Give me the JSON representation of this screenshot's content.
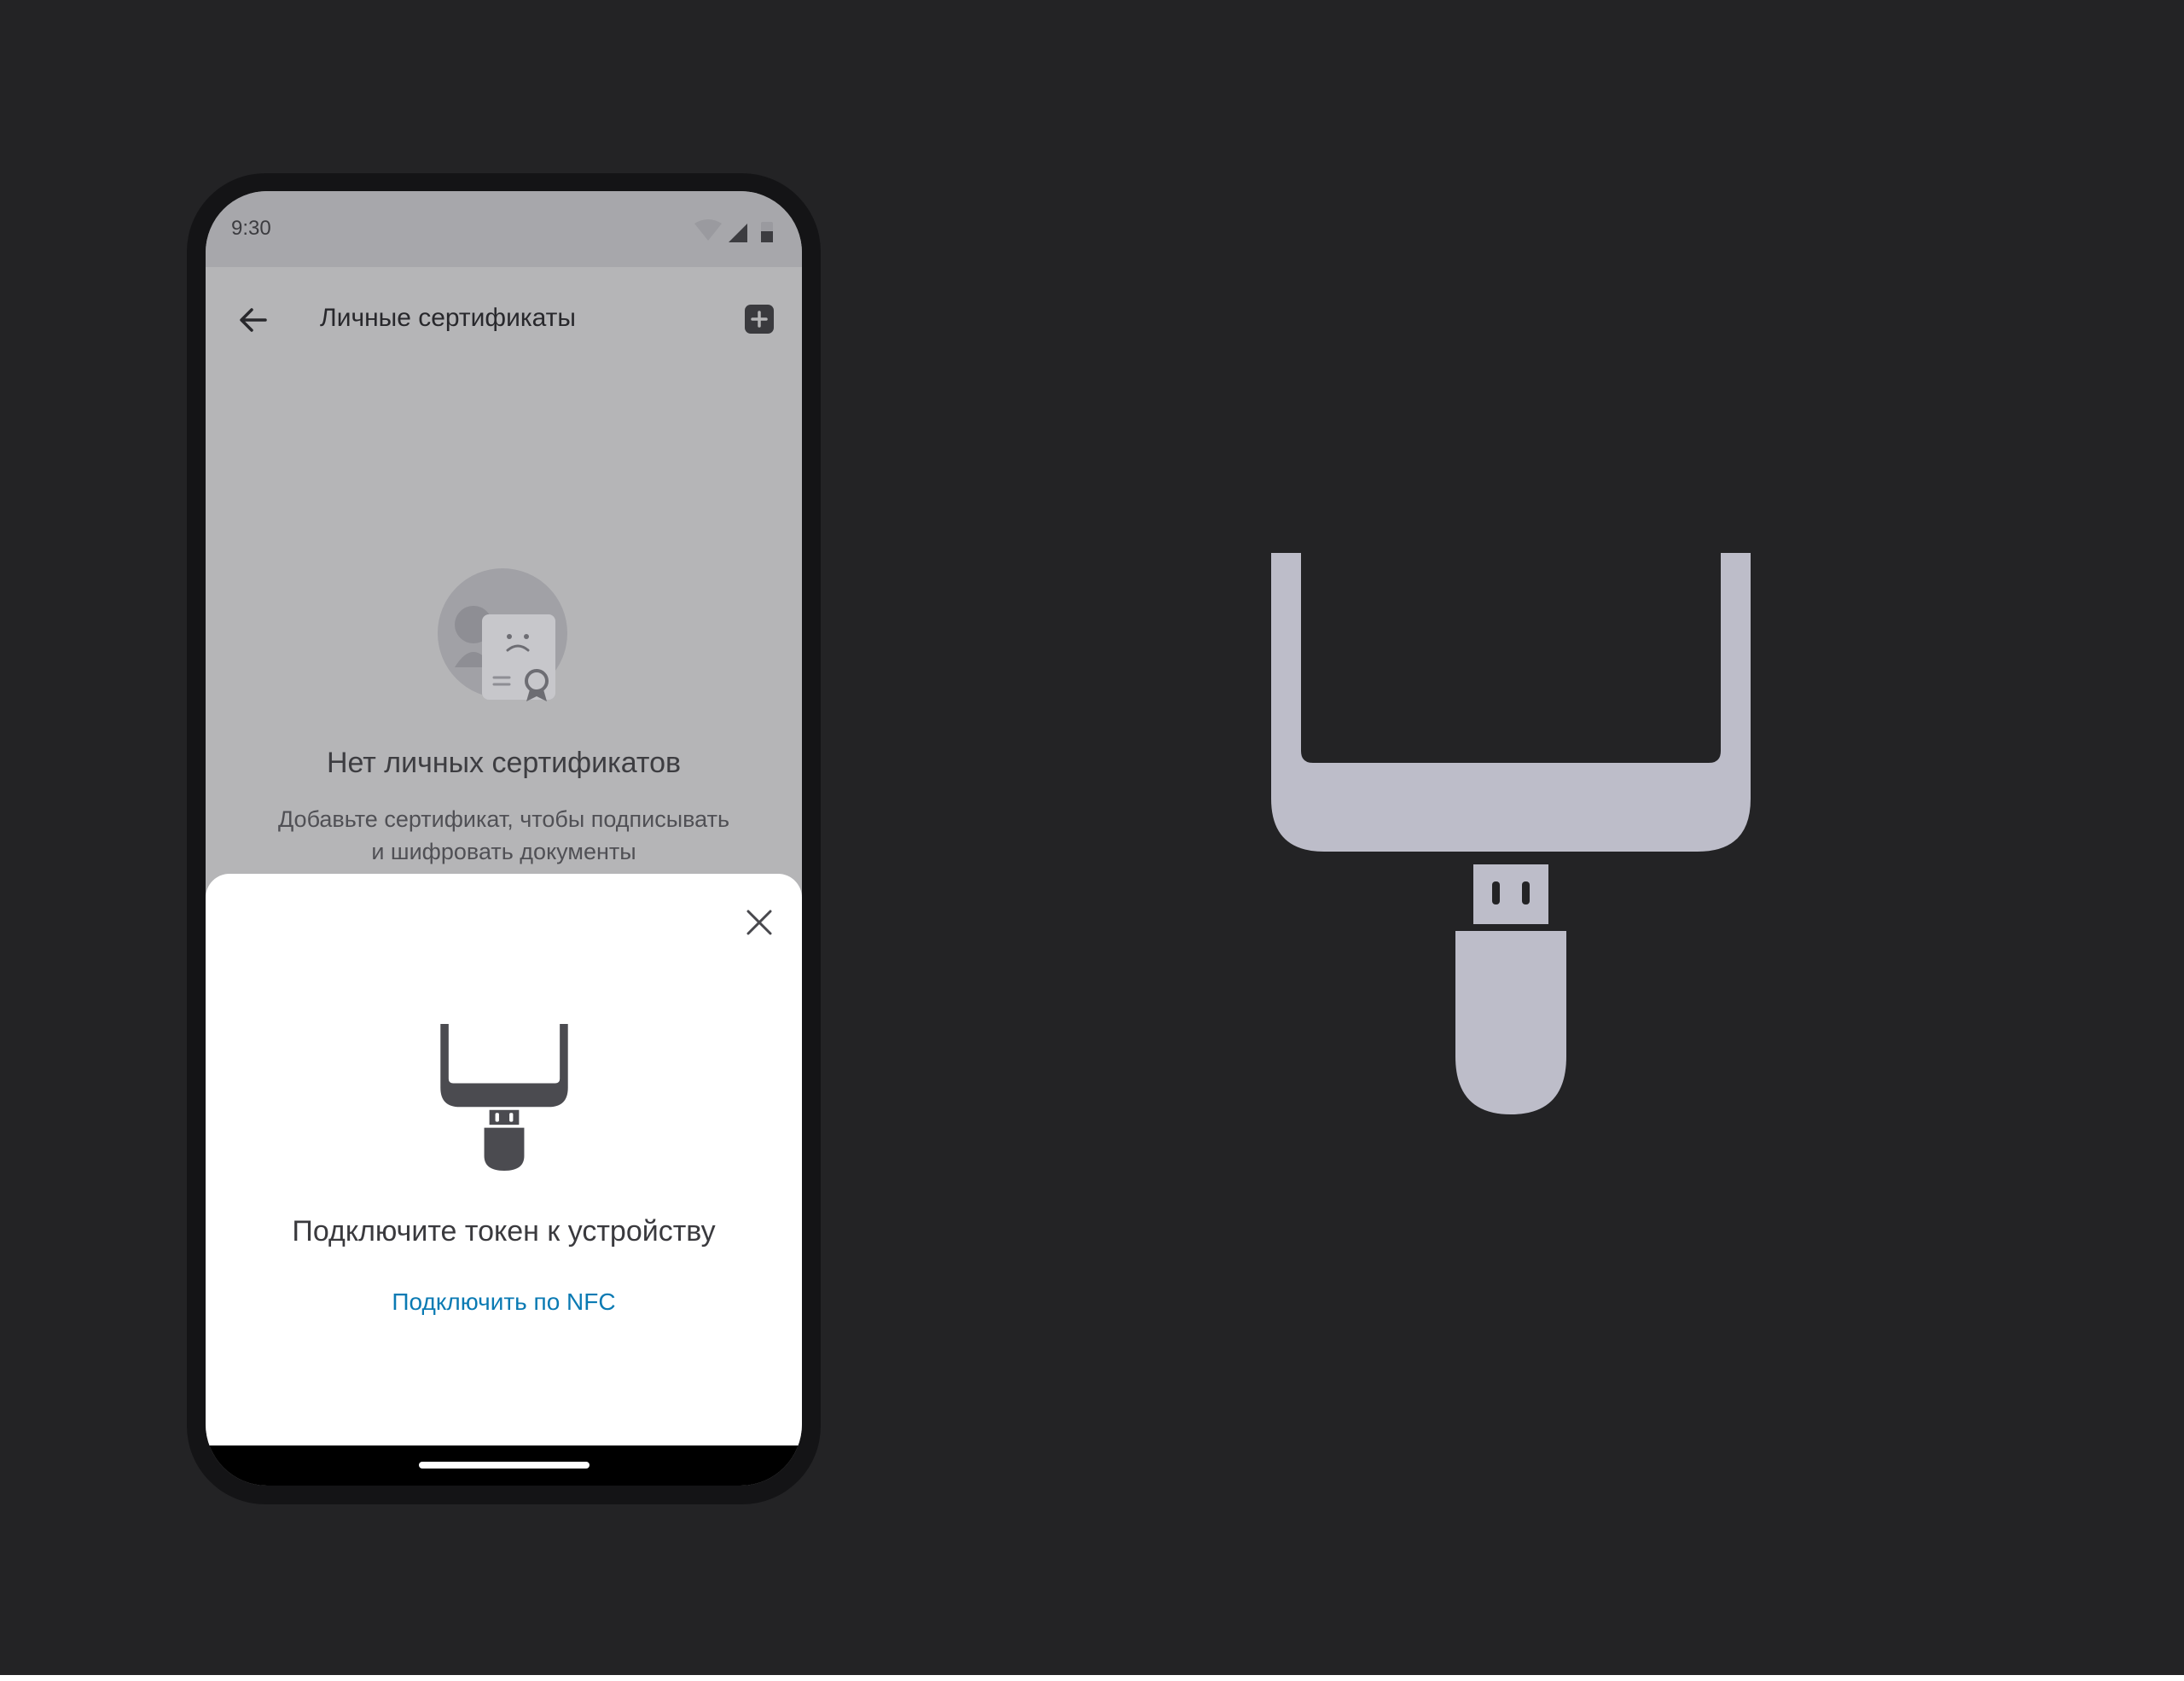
{
  "status_bar": {
    "time": "9:30",
    "icons": [
      "wifi-icon",
      "cellular-signal-icon",
      "battery-icon"
    ]
  },
  "app_bar": {
    "back_icon": "arrow-left-icon",
    "title": "Личные сертификаты",
    "add_icon": "plus-square-icon"
  },
  "empty_state": {
    "illustration": "no-certificates-illustration",
    "title": "Нет личных сертификатов",
    "description_lines": [
      "Добавьте сертификат, чтобы подписывать",
      "и шифровать документы"
    ]
  },
  "bottom_sheet": {
    "close_icon": "close-icon",
    "icon": "usb-token-icon",
    "title": "Подключите токен к устройству",
    "nfc_link": "Подключить по NFC"
  },
  "large_icon": {
    "icon": "usb-token-icon"
  },
  "colors": {
    "background": "#232325",
    "scrim": "#b5b5b7",
    "link": "#0a7ab3",
    "icon_dark": "#4b4b50",
    "icon_light": "#bdbdc9"
  }
}
